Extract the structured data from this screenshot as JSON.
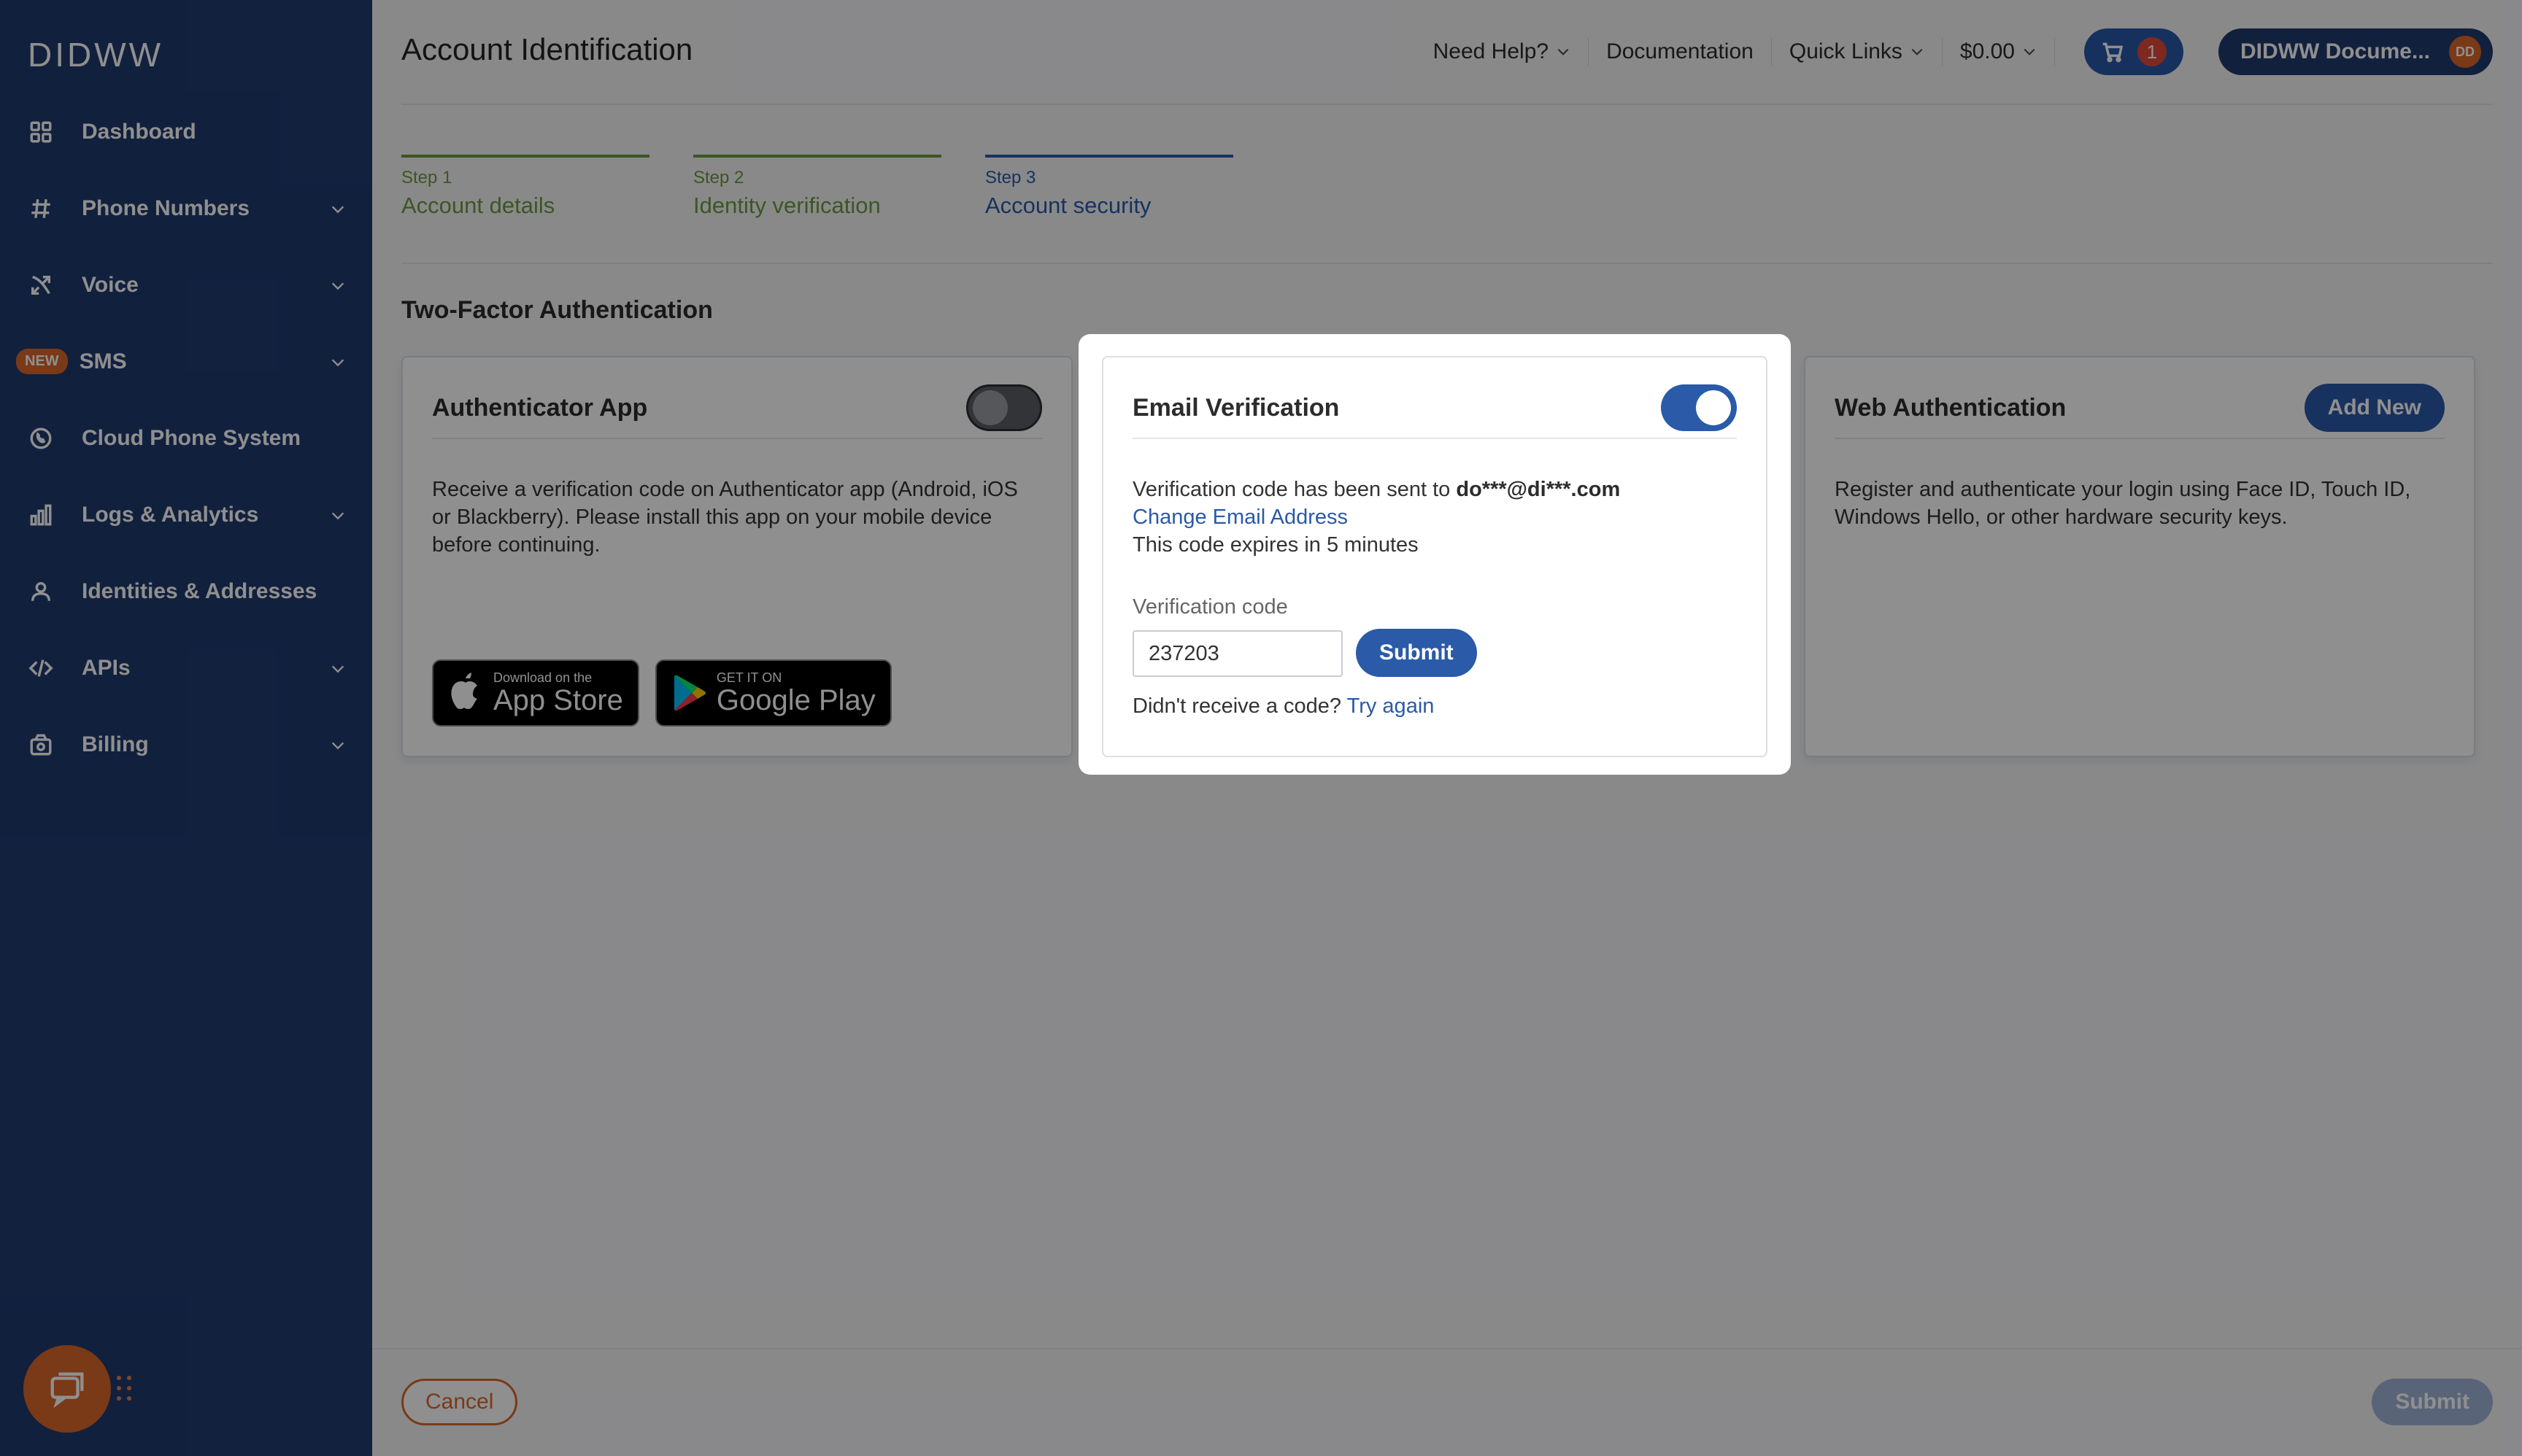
{
  "brand": {
    "logo": "DIDWW",
    "sidebar_bg": "#1f3a6e",
    "accent": "#2a5aa8",
    "orange": "#d9662a"
  },
  "sidebar": {
    "items": [
      {
        "label": "Dashboard",
        "icon": "grid-icon"
      },
      {
        "label": "Phone Numbers",
        "icon": "hash-icon"
      },
      {
        "label": "Voice",
        "icon": "phone-arrows-icon"
      },
      {
        "label": "SMS",
        "icon": "none",
        "badge": "NEW"
      },
      {
        "label": "Cloud Phone System",
        "icon": "phone-circle-icon"
      },
      {
        "label": "Logs & Analytics",
        "icon": "bar-chart-icon"
      },
      {
        "label": "Identities & Addresses",
        "icon": "user-icon"
      },
      {
        "label": "APIs",
        "icon": "code-icon"
      },
      {
        "label": "Billing",
        "icon": "wallet-icon"
      }
    ]
  },
  "header": {
    "title": "Account Identification",
    "need_help": "Need Help?",
    "documentation": "Documentation",
    "quick_links": "Quick Links",
    "balance": "$0.00",
    "cart_count": "1",
    "account_name": "DIDWW Docume...",
    "avatar_initials": "DD"
  },
  "steps": [
    {
      "num": "Step 1",
      "name": "Account details"
    },
    {
      "num": "Step 2",
      "name": "Identity verification"
    },
    {
      "num": "Step 3",
      "name": "Account security"
    }
  ],
  "section_title": "Two-Factor Authentication",
  "authenticator": {
    "title": "Authenticator App",
    "description": "Receive a verification code on Authenticator app (Android, iOS or Blackberry). Please install this app on your mobile device before continuing.",
    "appstore_small": "Download on the",
    "appstore_big": "App Store",
    "googleplay_small": "GET IT ON",
    "googleplay_big": "Google Play"
  },
  "email": {
    "title": "Email Verification",
    "sent_prefix": "Verification code has been sent to ",
    "sent_email": "do***@di***.com",
    "change_link": "Change Email Address",
    "expires": "This code expires in 5 minutes",
    "code_label": "Verification code",
    "code_value": "237203",
    "submit": "Submit",
    "resend_prefix": "Didn't receive a code? ",
    "resend_link": "Try again"
  },
  "webauthn": {
    "title": "Web Authentication",
    "add_new": "Add New",
    "description": "Register and authenticate your login using Face ID, Touch ID, Windows Hello, or other hardware security keys."
  },
  "footer": {
    "cancel": "Cancel",
    "submit": "Submit"
  }
}
